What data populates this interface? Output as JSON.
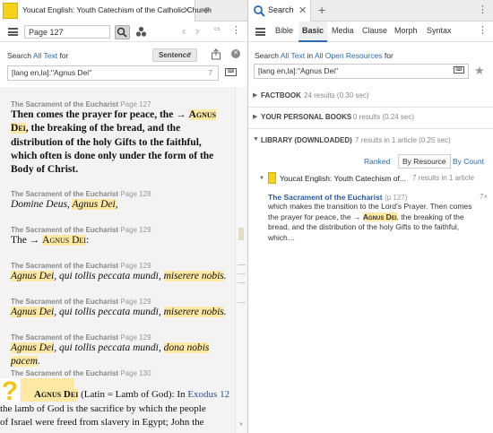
{
  "left": {
    "tab_title": "Youcat English: Youth Catechism of the Catholic Church",
    "reference": "Page 127",
    "search_prefix": "Search ",
    "search_all_text": "All Text",
    "search_for": " for",
    "sentence_label": "Sentence",
    "query": "[lang en,la]:\"Agnus Dei\"",
    "query_count": "7",
    "entries": [
      {
        "section": "The Sacrament of the Eucharist",
        "page": "Page 127"
      },
      {
        "section": "The Sacrament of the Eucharist",
        "page": "Page 128"
      },
      {
        "section": "The Sacrament of the Eucharist",
        "page": "Page 129"
      },
      {
        "section": "The Sacrament of the Eucharist",
        "page": "Page 129"
      },
      {
        "section": "The Sacrament of the Eucharist",
        "page": "Page 129"
      },
      {
        "section": "The Sacrament of the Eucharist",
        "page": "Page 129"
      },
      {
        "section": "The Sacrament of the Eucharist",
        "page": "Page 130"
      }
    ],
    "e1": {
      "a": "Then comes the prayer for peace, the → ",
      "b": "Agnus Dei",
      "c": ", the breaking of the bread, and the distribution of the holy Gifts to the faithful, which often is done only under the form of the Body of Christ."
    },
    "e2": {
      "a": "Domine Deus, ",
      "b": "Agnus Dei",
      ",c": ","
    },
    "e3": {
      "a": "The → ",
      "b": "Agnus Dei",
      "c": ":"
    },
    "e4": {
      "b": "Agnus Dei",
      "a": ", qui tollis peccata mundi, ",
      "c": "miserere nobis",
      "d": "."
    },
    "e5": {
      "b": "Agnus Dei",
      "a": ", qui tollis peccata mundi, ",
      "c": "miserere nobis",
      "d": "."
    },
    "e6": {
      "b": "Agnus Dei",
      "a": ", qui tollis peccata mundi, ",
      "c": "dona nobis pacem",
      "d": "."
    },
    "e7": {
      "b": "Agnus Dei",
      "a": " (Latin = Lamb of God): In ",
      "link": "Exodus 12",
      "c": "the lamb of God is the sacrifice by which the people",
      "d": "of Israel were freed from slavery in Egypt; John the"
    }
  },
  "right": {
    "tab_title": "Search",
    "tabs": [
      "Bible",
      "Basic",
      "Media",
      "Clause",
      "Morph",
      "Syntax"
    ],
    "search_prefix": "Search ",
    "search_all_text": "All Text",
    "search_in": " in ",
    "search_resources": "All Open Resources",
    "search_for": " for",
    "query": "[lang en,la]:\"Agnus Dei\"",
    "factbook": "FACTBOOK",
    "factbook_info": "24 results (0.30 sec)",
    "personal": "YOUR PERSONAL BOOKS",
    "personal_info": "0 results (0.24 sec)",
    "library": "LIBRARY (DOWNLOADED)",
    "library_info": "7 results in 1 article (0.25 sec)",
    "ranked": "Ranked",
    "by_resource": "By Resource",
    "by_count": "By Count",
    "res_title": "Youcat English: Youth Catechism of...",
    "res_info": "7 results in 1 article",
    "hit_title": "The Sacrament of the Eucharist",
    "hit_page": "(p 127)",
    "hit_count": "7×",
    "hit_a": "which makes the transition to the Lord’s Prayer. Then comes",
    "hit_b": "the prayer for peace, the → ",
    "hit_hl": "Agnus Dei",
    "hit_c": ", the breaking of the",
    "hit_d": "bread, and the distribution of the holy Gifts to the faithful,",
    "hit_e": "which…"
  }
}
